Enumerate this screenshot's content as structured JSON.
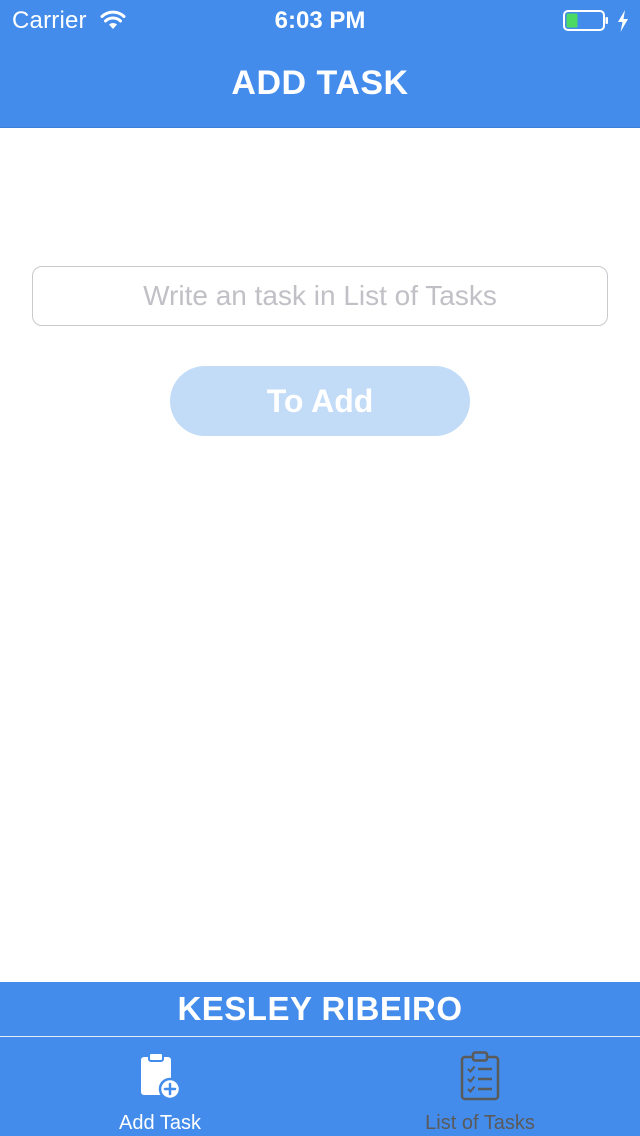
{
  "status_bar": {
    "carrier": "Carrier",
    "time": "6:03 PM"
  },
  "nav": {
    "title": "ADD TASK"
  },
  "form": {
    "input_value": "",
    "input_placeholder": "Write an task in List of Tasks",
    "add_button_label": "To Add"
  },
  "footer": {
    "author": "KESLEY RIBEIRO"
  },
  "tabs": [
    {
      "label": "Add Task",
      "icon": "clipboard-add-icon",
      "selected": true
    },
    {
      "label": "List of Tasks",
      "icon": "checklist-icon",
      "selected": false
    }
  ],
  "colors": {
    "primary": "#438ceb",
    "button_disabled": "#c2dcf8",
    "battery_fill": "#4cd964",
    "tab_inactive": "#5a5a5a"
  }
}
